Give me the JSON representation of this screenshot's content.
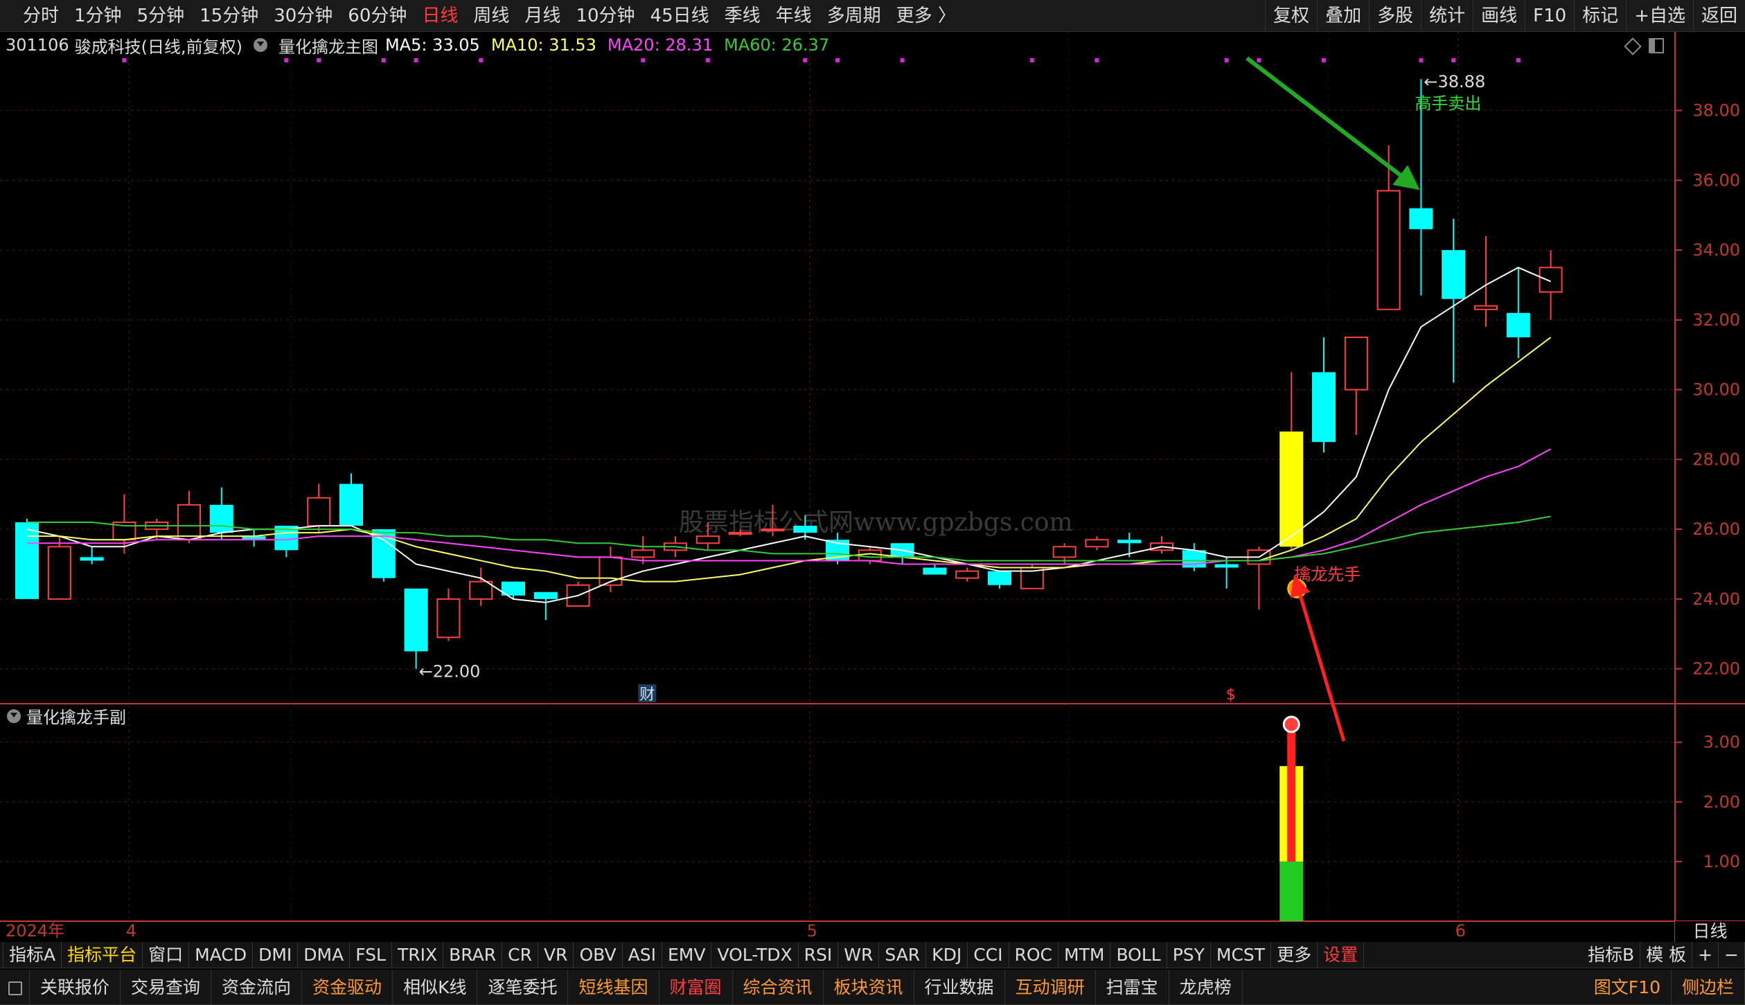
{
  "topbar": {
    "periods": [
      "分时",
      "1分钟",
      "5分钟",
      "15分钟",
      "30分钟",
      "60分钟",
      "日线",
      "周线",
      "月线",
      "10分钟",
      "45日线",
      "季线",
      "年线",
      "多周期",
      "更多 〉"
    ],
    "active_period": "日线",
    "right_items": [
      "复权",
      "叠加",
      "多股",
      "统计",
      "画线",
      "F10",
      "标记",
      "+自选",
      "返回"
    ]
  },
  "info": {
    "code": "301106",
    "name": "骏成科技",
    "mode": "(日线,前复权)",
    "indicator": "量化擒龙主图",
    "ma5": "MA5: 33.05",
    "ma10": "MA10: 31.53",
    "ma20": "MA20: 28.31",
    "ma60": "MA60: 26.37"
  },
  "colors": {
    "up": "#ff4040",
    "down": "#00ffff",
    "ma5": "#ffffff",
    "ma10": "#ffff66",
    "ma20": "#ff44ff",
    "ma60": "#33cc33",
    "axis": "#c0392b",
    "highlight": "#ffff00"
  },
  "chart_data": [
    {
      "type": "candlestick",
      "title": "量化擒龙主图",
      "ylim": [
        21,
        39.5
      ],
      "yticks": [
        22,
        24,
        26,
        28,
        30,
        32,
        34,
        36,
        38
      ],
      "ytick_labels": [
        "22.00",
        "24.00",
        "26.00",
        "28.00",
        "30.00",
        "32.00",
        "34.00",
        "36.00",
        "38.00"
      ],
      "x_labels": [
        {
          "index": 0,
          "text": "2024年"
        },
        {
          "index": 3,
          "text": "4"
        },
        {
          "index": 24,
          "text": "5"
        },
        {
          "index": 44,
          "text": "6"
        }
      ],
      "candles": [
        {
          "o": 26.2,
          "h": 26.3,
          "l": 24.0,
          "c": 24.0
        },
        {
          "o": 24.0,
          "h": 25.8,
          "l": 24.0,
          "c": 25.5
        },
        {
          "o": 25.2,
          "h": 25.5,
          "l": 25.0,
          "c": 25.1
        },
        {
          "o": 25.7,
          "h": 27.0,
          "l": 25.3,
          "c": 26.2
        },
        {
          "o": 26.0,
          "h": 26.3,
          "l": 25.7,
          "c": 26.2
        },
        {
          "o": 25.7,
          "h": 27.1,
          "l": 25.6,
          "c": 26.7
        },
        {
          "o": 26.7,
          "h": 27.2,
          "l": 25.7,
          "c": 25.9
        },
        {
          "o": 25.8,
          "h": 26.0,
          "l": 25.5,
          "c": 25.7
        },
        {
          "o": 26.1,
          "h": 26.1,
          "l": 25.2,
          "c": 25.4
        },
        {
          "o": 26.1,
          "h": 27.3,
          "l": 25.9,
          "c": 26.9
        },
        {
          "o": 27.3,
          "h": 27.6,
          "l": 26.1,
          "c": 26.1
        },
        {
          "o": 26.0,
          "h": 26.0,
          "l": 24.5,
          "c": 24.6
        },
        {
          "o": 24.3,
          "h": 24.3,
          "l": 22.0,
          "c": 22.5
        },
        {
          "o": 22.9,
          "h": 24.3,
          "l": 22.8,
          "c": 24.0
        },
        {
          "o": 24.0,
          "h": 24.9,
          "l": 23.8,
          "c": 24.5
        },
        {
          "o": 24.5,
          "h": 24.5,
          "l": 24.0,
          "c": 24.1
        },
        {
          "o": 24.2,
          "h": 24.2,
          "l": 23.4,
          "c": 24.0
        },
        {
          "o": 23.8,
          "h": 24.5,
          "l": 23.8,
          "c": 24.4
        },
        {
          "o": 24.4,
          "h": 25.5,
          "l": 24.2,
          "c": 25.2
        },
        {
          "o": 25.2,
          "h": 25.8,
          "l": 25.0,
          "c": 25.4
        },
        {
          "o": 25.4,
          "h": 25.8,
          "l": 25.2,
          "c": 25.6
        },
        {
          "o": 25.6,
          "h": 26.2,
          "l": 25.4,
          "c": 25.8
        },
        {
          "o": 25.9,
          "h": 26.0,
          "l": 25.8,
          "c": 25.9
        },
        {
          "o": 26.0,
          "h": 26.7,
          "l": 25.8,
          "c": 26.0
        },
        {
          "o": 26.1,
          "h": 26.4,
          "l": 25.7,
          "c": 25.9
        },
        {
          "o": 25.7,
          "h": 25.9,
          "l": 25.0,
          "c": 25.1
        },
        {
          "o": 25.1,
          "h": 25.5,
          "l": 25.0,
          "c": 25.4
        },
        {
          "o": 25.6,
          "h": 25.6,
          "l": 25.0,
          "c": 25.2
        },
        {
          "o": 24.9,
          "h": 25.0,
          "l": 24.7,
          "c": 24.7
        },
        {
          "o": 24.6,
          "h": 24.9,
          "l": 24.5,
          "c": 24.8
        },
        {
          "o": 24.8,
          "h": 24.8,
          "l": 24.3,
          "c": 24.4
        },
        {
          "o": 24.3,
          "h": 25.0,
          "l": 24.3,
          "c": 24.9
        },
        {
          "o": 25.2,
          "h": 25.6,
          "l": 25.0,
          "c": 25.5
        },
        {
          "o": 25.5,
          "h": 25.8,
          "l": 25.4,
          "c": 25.7
        },
        {
          "o": 25.7,
          "h": 25.9,
          "l": 25.2,
          "c": 25.6
        },
        {
          "o": 25.4,
          "h": 25.8,
          "l": 25.3,
          "c": 25.6
        },
        {
          "o": 25.4,
          "h": 25.6,
          "l": 24.8,
          "c": 24.9
        },
        {
          "o": 25.0,
          "h": 25.2,
          "l": 24.3,
          "c": 24.9
        },
        {
          "o": 25.0,
          "h": 25.5,
          "l": 23.7,
          "c": 25.4
        },
        {
          "o": 25.5,
          "h": 30.5,
          "l": 25.4,
          "c": 28.8
        },
        {
          "o": 30.5,
          "h": 31.5,
          "l": 28.2,
          "c": 28.5
        },
        {
          "o": 30.0,
          "h": 31.5,
          "l": 28.7,
          "c": 31.5
        },
        {
          "o": 32.3,
          "h": 37.0,
          "l": 32.3,
          "c": 35.7
        },
        {
          "o": 35.2,
          "h": 38.9,
          "l": 32.7,
          "c": 34.6
        },
        {
          "o": 34.0,
          "h": 34.9,
          "l": 30.2,
          "c": 32.6
        },
        {
          "o": 32.3,
          "h": 34.4,
          "l": 31.8,
          "c": 32.4
        },
        {
          "o": 32.2,
          "h": 33.5,
          "l": 30.9,
          "c": 31.5
        },
        {
          "o": 32.8,
          "h": 34.0,
          "l": 32.0,
          "c": 33.5
        }
      ],
      "series": [
        {
          "name": "MA5",
          "values": [
            26.0,
            25.8,
            25.5,
            25.5,
            25.8,
            25.7,
            25.9,
            26.0,
            26.0,
            26.1,
            26.1,
            25.7,
            25.0,
            24.8,
            24.6,
            24.0,
            23.9,
            24.1,
            24.5,
            24.8,
            25.0,
            25.2,
            25.4,
            25.6,
            25.8,
            25.6,
            25.5,
            25.4,
            25.2,
            25.0,
            24.8,
            24.8,
            24.9,
            25.1,
            25.3,
            25.5,
            25.4,
            25.2,
            25.2,
            25.8,
            26.5,
            27.5,
            30.0,
            31.8,
            32.4,
            33.0,
            33.5,
            33.1
          ]
        },
        {
          "name": "MA10",
          "values": [
            25.8,
            25.8,
            25.7,
            25.7,
            25.8,
            25.8,
            25.8,
            25.8,
            25.9,
            25.9,
            26.0,
            25.8,
            25.5,
            25.3,
            25.1,
            24.9,
            24.8,
            24.6,
            24.6,
            24.5,
            24.5,
            24.6,
            24.7,
            24.9,
            25.1,
            25.2,
            25.3,
            25.2,
            25.1,
            25.0,
            24.9,
            24.9,
            24.9,
            25.0,
            25.0,
            25.1,
            25.1,
            25.1,
            25.1,
            25.4,
            25.8,
            26.3,
            27.5,
            28.5,
            29.3,
            30.1,
            30.8,
            31.5
          ]
        },
        {
          "name": "MA20",
          "values": [
            25.6,
            25.6,
            25.6,
            25.6,
            25.7,
            25.7,
            25.7,
            25.7,
            25.7,
            25.8,
            25.8,
            25.8,
            25.7,
            25.6,
            25.5,
            25.4,
            25.3,
            25.2,
            25.2,
            25.1,
            25.1,
            25.1,
            25.1,
            25.1,
            25.1,
            25.1,
            25.1,
            25.0,
            25.0,
            25.0,
            25.0,
            25.0,
            25.0,
            25.0,
            25.0,
            25.0,
            25.0,
            25.1,
            25.1,
            25.2,
            25.4,
            25.7,
            26.2,
            26.7,
            27.1,
            27.5,
            27.8,
            28.3
          ]
        },
        {
          "name": "MA60",
          "values": [
            26.2,
            26.2,
            26.2,
            26.1,
            26.1,
            26.1,
            26.1,
            26.0,
            26.0,
            26.0,
            26.0,
            25.9,
            25.9,
            25.8,
            25.8,
            25.7,
            25.7,
            25.6,
            25.6,
            25.5,
            25.5,
            25.4,
            25.4,
            25.3,
            25.3,
            25.3,
            25.2,
            25.2,
            25.2,
            25.1,
            25.1,
            25.1,
            25.1,
            25.1,
            25.1,
            25.1,
            25.1,
            25.1,
            25.1,
            25.2,
            25.3,
            25.5,
            25.7,
            25.9,
            26.0,
            26.1,
            26.2,
            26.37
          ]
        }
      ],
      "highlight_index": 39,
      "annotations": [
        {
          "index": 12,
          "price": 22.0,
          "text": "←22.00",
          "color": "#dddddd"
        },
        {
          "index": 43,
          "price": 38.9,
          "text": "←38.88",
          "color": "#dddddd"
        },
        {
          "index": 43,
          "price": 38.4,
          "text": "高手卖出",
          "color": "#33dd33"
        },
        {
          "index": 39,
          "price": 25.1,
          "text": "擒龙先手",
          "color": "#ff3b3b"
        }
      ],
      "markers": [
        {
          "index": 19,
          "text": "财"
        },
        {
          "index": 37,
          "text": "$"
        }
      ],
      "top_dots": [
        3,
        8,
        9,
        11,
        12,
        14,
        19,
        21,
        24,
        25,
        27,
        31,
        33,
        37,
        38,
        40,
        43,
        44,
        46
      ]
    },
    {
      "type": "bar",
      "title": "量化擒龙手副",
      "ylim": [
        0,
        3.6
      ],
      "yticks": [
        1,
        2,
        3
      ],
      "ytick_labels": [
        "1.00",
        "2.00",
        "3.00"
      ],
      "index": 39,
      "segments": [
        {
          "from": 0,
          "to": 1.0,
          "color": "#22cc22"
        },
        {
          "from": 1.0,
          "to": 2.6,
          "color": "#ffff00"
        },
        {
          "from": 1.0,
          "to": 3.3,
          "color": "#ff2020",
          "thin": true
        }
      ],
      "marker_top": 3.3
    }
  ],
  "date_label": "日线",
  "watermark": "股票指标公式网www.gpzbgs.com",
  "indexbar": {
    "items": [
      "指标A",
      "指标平台",
      "窗口",
      "MACD",
      "DMI",
      "DMA",
      "FSL",
      "TRIX",
      "BRAR",
      "CR",
      "VR",
      "OBV",
      "ASI",
      "EMV",
      "VOL-TDX",
      "RSI",
      "WR",
      "SAR",
      "KDJ",
      "CCI",
      "ROC",
      "MTM",
      "BOLL",
      "PSY",
      "MCST",
      "更多",
      "设置"
    ],
    "right_items": [
      "指标B",
      "模 板",
      "+",
      "−"
    ]
  },
  "bottombar": {
    "items": [
      "关联报价",
      "交易查询",
      "资金流向",
      "资金驱动",
      "相似K线",
      "逐笔委托",
      "短线基因",
      "财富圈",
      "综合资讯",
      "板块资讯",
      "行业数据",
      "互动调研",
      "扫雷宝",
      "龙虎榜"
    ],
    "right_items": [
      "图文F10",
      "侧边栏"
    ]
  }
}
